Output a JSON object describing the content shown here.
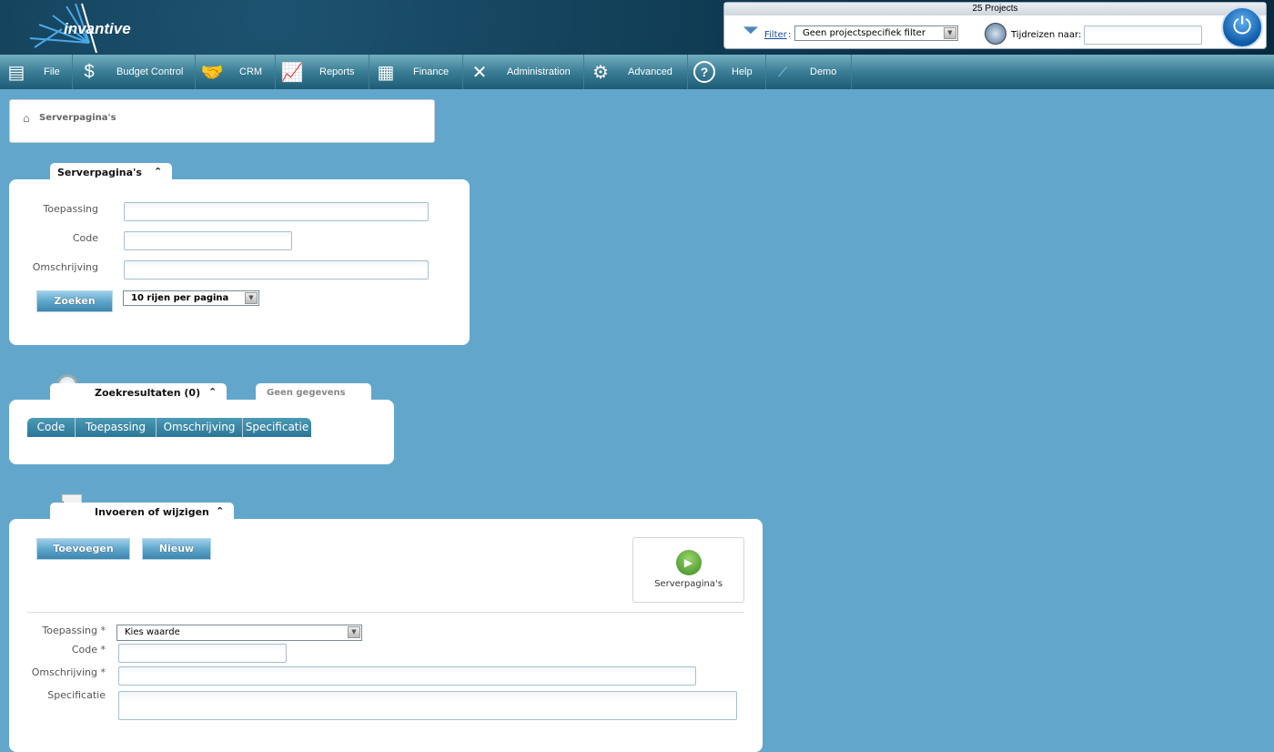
{
  "header": {
    "logo_text": "invantive",
    "projects_count": "25 Projects",
    "filter_label": "Filter",
    "filter_colon": ":",
    "filter_value": "Geen projectspecifiek filter",
    "timetravel_label": "Tijdreizen naar:",
    "timetravel_value": ""
  },
  "nav": [
    {
      "label": "File",
      "icon": "file-cabinet-icon"
    },
    {
      "label": "Budget Control",
      "icon": "money-bag-icon"
    },
    {
      "label": "CRM",
      "icon": "handshake-icon"
    },
    {
      "label": "Reports",
      "icon": "presentation-chart-icon"
    },
    {
      "label": "Finance",
      "icon": "calculator-icon"
    },
    {
      "label": "Administration",
      "icon": "tools-icon"
    },
    {
      "label": "Advanced",
      "icon": "gears-icon"
    },
    {
      "label": "Help",
      "icon": "help-icon"
    },
    {
      "label": "Demo",
      "icon": "invantive-logo-icon"
    }
  ],
  "breadcrumb": {
    "label": "Serverpagina's"
  },
  "search": {
    "tab_title": "Serverpagina's",
    "fields": [
      {
        "label": "Toepassing",
        "value": ""
      },
      {
        "label": "Code",
        "value": ""
      },
      {
        "label": "Omschrijving",
        "value": ""
      }
    ],
    "search_button": "Zoeken",
    "rows_per_page": "10 rijen per pagina"
  },
  "results": {
    "tab_title": "Zoekresultaten (0)",
    "status_tab": "Geen gegevens",
    "columns": [
      "Code",
      "Toepassing",
      "Omschrijving",
      "Specificatie"
    ]
  },
  "edit": {
    "tab_title": "Invoeren of wijzigen",
    "add_button": "Toevoegen",
    "new_button": "Nieuw",
    "shortcut_label": "Serverpagina's",
    "fields": [
      {
        "label": "Toepassing *",
        "value": "Kies waarde"
      },
      {
        "label": "Code *",
        "value": ""
      },
      {
        "label": "Omschrijving *",
        "value": ""
      },
      {
        "label": "Specificatie",
        "value": ""
      }
    ]
  },
  "colors": {
    "background": "#62a7cb",
    "header": "#0c3249",
    "accent": "#2b7696"
  }
}
